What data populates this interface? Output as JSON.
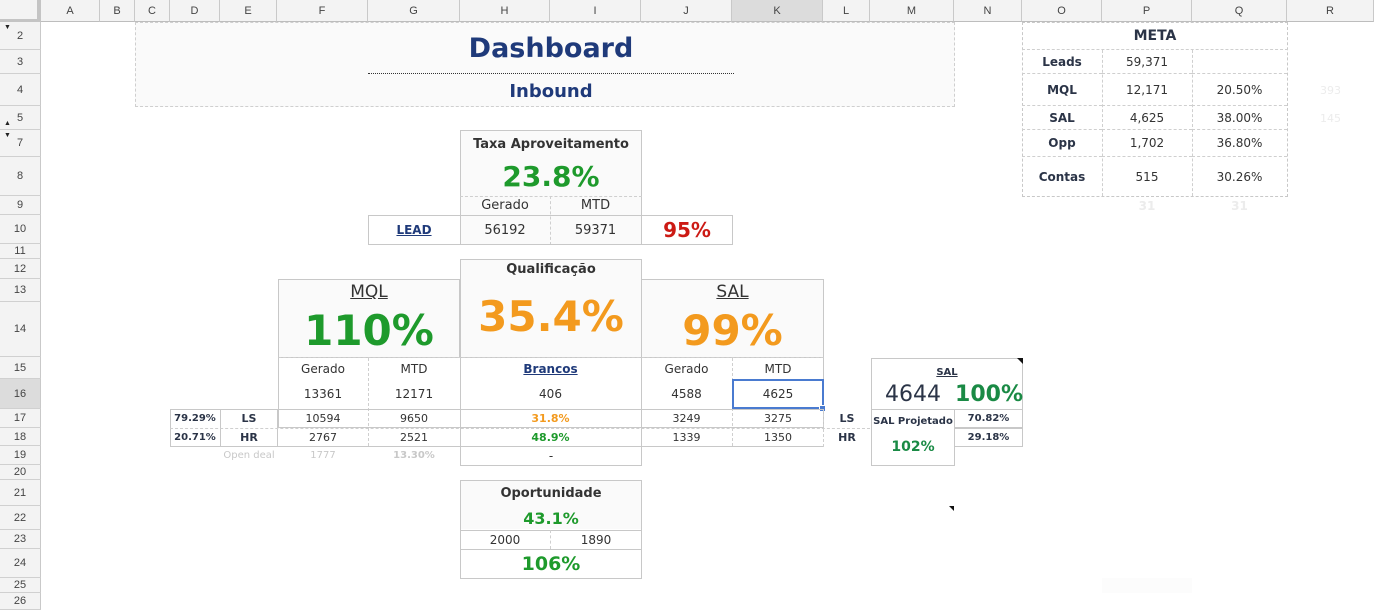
{
  "sheet": {
    "columns": [
      "A",
      "B",
      "C",
      "D",
      "E",
      "F",
      "G",
      "H",
      "I",
      "J",
      "K",
      "L",
      "M",
      "N",
      "O",
      "P",
      "Q",
      "R"
    ],
    "selected_column": "K",
    "rows": [
      "2",
      "3",
      "4",
      "5",
      "7",
      "8",
      "9",
      "10",
      "11",
      "12",
      "13",
      "14",
      "15",
      "16",
      "17",
      "18",
      "19",
      "20",
      "21",
      "22",
      "23",
      "24",
      "25",
      "26"
    ],
    "selected_row": "16"
  },
  "header": {
    "title": "Dashboard",
    "subtitle": "Inbound"
  },
  "meta": {
    "title": "META",
    "rows": [
      {
        "label": "Leads",
        "value": "59,371",
        "pct": ""
      },
      {
        "label": "MQL",
        "value": "12,171",
        "pct": "20.50%"
      },
      {
        "label": "SAL",
        "value": "4,625",
        "pct": "38.00%"
      },
      {
        "label": "Opp",
        "value": "1,702",
        "pct": "36.80%"
      },
      {
        "label": "Contas",
        "value": "515",
        "pct": "30.26%"
      }
    ],
    "side_values": [
      "393",
      "145"
    ],
    "below_values": [
      "31",
      "31"
    ]
  },
  "taxa": {
    "title": "Taxa Aproveitamento",
    "value": "23.8%",
    "gerado_label": "Gerado",
    "mtd_label": "MTD",
    "lead_label": "LEAD",
    "gerado": "56192",
    "mtd": "59371",
    "pct": "95%"
  },
  "qualificacao": {
    "title": "Qualificação",
    "value": "35.4%",
    "brancos_label": "Brancos",
    "brancos": "406",
    "ls_pct": "31.8%",
    "hr_pct": "48.9%",
    "bottom": "-"
  },
  "mql": {
    "title": "MQL",
    "value": "110%",
    "gerado_label": "Gerado",
    "mtd_label": "MTD",
    "gerado": "13361",
    "mtd": "12171",
    "ls_share": "79.29%",
    "hr_share": "20.71%",
    "ls_label": "LS",
    "hr_label": "HR",
    "ls_gerado": "10594",
    "ls_mtd": "9650",
    "hr_gerado": "2767",
    "hr_mtd": "2521",
    "open_deal_label": "Open deal",
    "open_deal_value": "1777",
    "open_deal_pct": "13.30%"
  },
  "sal": {
    "title": "SAL",
    "value": "99%",
    "gerado_label": "Gerado",
    "mtd_label": "MTD",
    "gerado": "4588",
    "mtd": "4625",
    "ls_label": "LS",
    "hr_label": "HR",
    "ls_gerado": "3249",
    "ls_mtd": "3275",
    "hr_gerado": "1339",
    "hr_mtd": "1350"
  },
  "sal_projection": {
    "title": "SAL",
    "value": "4644",
    "pct": "100%",
    "projected_label": "SAL Projetado",
    "projected_pct": "102%",
    "ls_share": "70.82%",
    "hr_share": "29.18%"
  },
  "oportunidade": {
    "title": "Oportunidade",
    "value": "43.1%",
    "left": "2000",
    "right": "1890",
    "pct": "106%"
  }
}
